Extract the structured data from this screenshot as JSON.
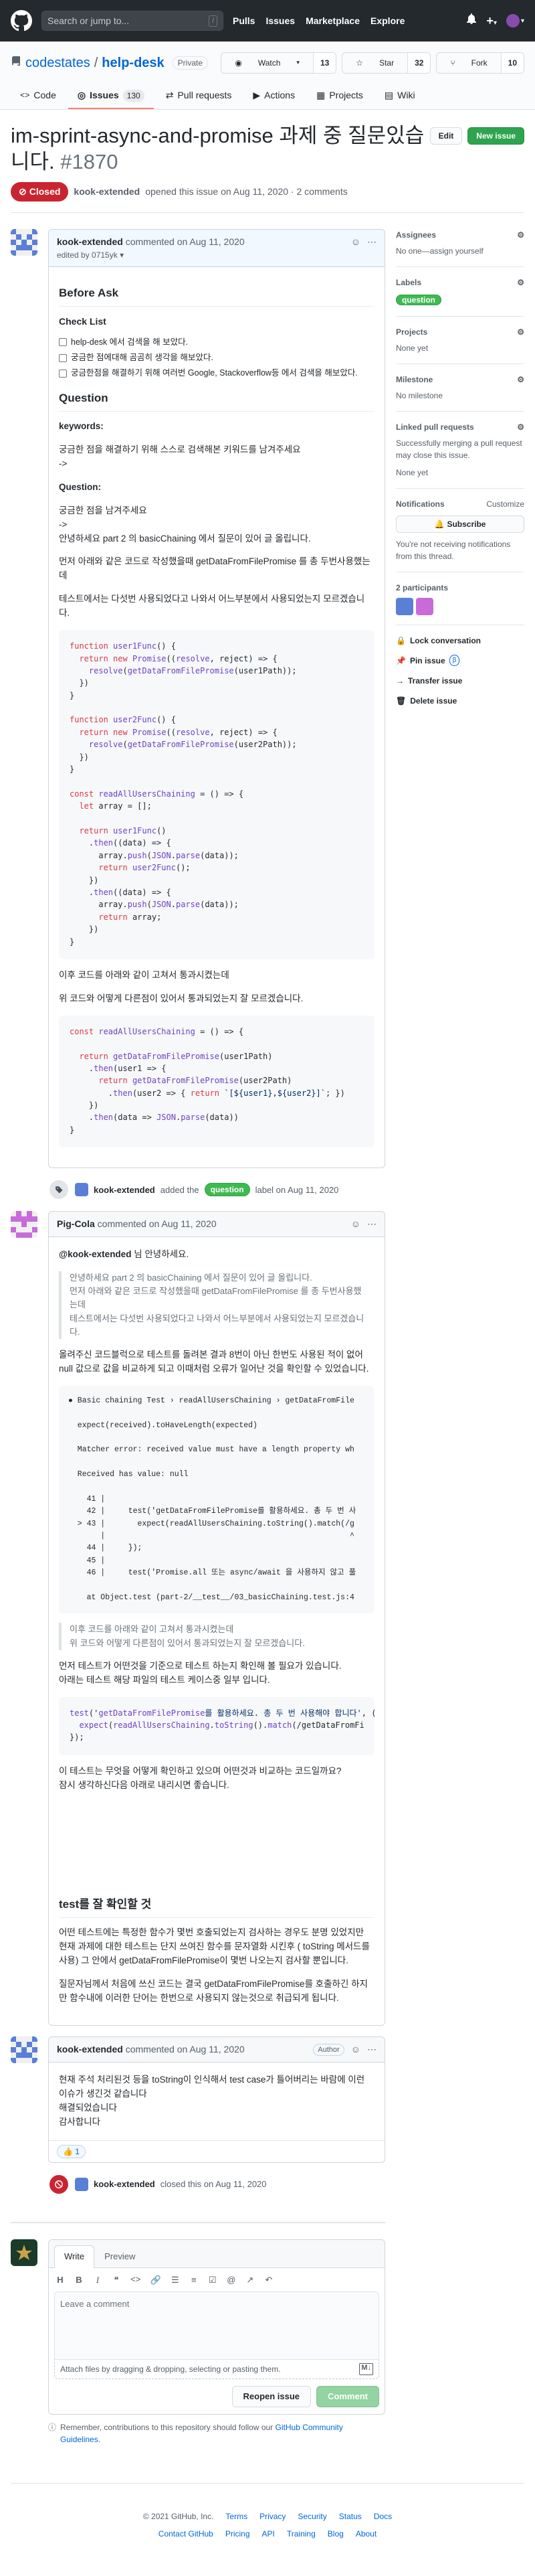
{
  "header": {
    "search_placeholder": "Search or jump to...",
    "search_hint": "/",
    "nav": [
      "Pulls",
      "Issues",
      "Marketplace",
      "Explore"
    ],
    "plus": "+",
    "caret": "▾"
  },
  "repo": {
    "owner": "codestates",
    "separator": "/",
    "name": "help-desk",
    "visibility": "Private",
    "watch": {
      "label": "Watch",
      "count": "13"
    },
    "star": {
      "label": "Star",
      "count": "32"
    },
    "fork": {
      "label": "Fork",
      "count": "10"
    },
    "tabs": [
      {
        "label": "Code"
      },
      {
        "label": "Issues",
        "count": "130"
      },
      {
        "label": "Pull requests"
      },
      {
        "label": "Actions"
      },
      {
        "label": "Projects"
      },
      {
        "label": "Wiki"
      }
    ]
  },
  "issue": {
    "title": "im-sprint-async-and-promise 과제 중 질문있습니다.",
    "number": "#1870",
    "edit_label": "Edit",
    "new_issue_label": "New issue",
    "state": "Closed",
    "author": "kook-extended",
    "opened_text": "opened this issue on Aug 11, 2020 · 2 comments"
  },
  "colors": {
    "accent": "#0366d6",
    "closed": "#cb2431",
    "open": "#2ea44f",
    "label_question": "#3fb950"
  },
  "first_comment": {
    "author": "kook-extended",
    "date_text": "commented on Aug 11, 2020",
    "edited_text": "edited by 0715yk",
    "h_before": "Before Ask",
    "h_checklist": "Check List",
    "checklist": [
      "help-desk 에서 검색을 해 보았다.",
      "궁금한 점에대해 곰곰히 생각을 해보았다.",
      "궁금한점을 해결하기 위해 여러번 Google, Stackoverflow등 에서 검색을 해보았다."
    ],
    "h_question": "Question",
    "keywords_label": "keywords:",
    "keywords_text": "궁금한 점을 해결하기 위해 스스로 검색해본 키워드를 남겨주세요",
    "arrow1": "->",
    "question_label": "Question:",
    "question_text": "궁금한 점을 남겨주세요",
    "arrow2": "->",
    "p1": "안녕하세요 part 2 의 basicChaining 에서 질문이 있어 글 올립니다.",
    "p2": "먼저 아래와 같은 코드로 작성했을때 getDataFromFilePromise 를 총 두번사용했는데",
    "p3": "테스트에서는 다섯번 사용되었다고 나와서 어느부분에서 사용되었는지 모르겠습니다.",
    "code1": "function user1Func() {\n  return new Promise((resolve, reject) => {\n    resolve(getDataFromFilePromise(user1Path));\n  })\n}\n\nfunction user2Func() {\n  return new Promise((resolve, reject) => {\n    resolve(getDataFromFilePromise(user2Path));\n  })\n}\n\nconst readAllUsersChaining = () => {\n  let array = [];\n\n  return user1Func()\n    .then((data) => {\n      array.push(JSON.parse(data));\n      return user2Func();\n    })\n    .then((data) => {\n      array.push(JSON.parse(data));\n      return array;\n    })\n}",
    "p4": "이후 코드를 아래와 같이 고쳐서 통과시켰는데",
    "p5": "위 코드와 어떻게 다른점이 있어서 통과되었는지 잘 모르겠습니다.",
    "code2": "const readAllUsersChaining = () => {\n\n  return getDataFromFilePromise(user1Path)\n    .then(user1 => {\n      return getDataFromFilePromise(user2Path)\n        .then(user2 => { return `[${user1},${user2}]`; })\n    })\n    .then(data => JSON.parse(data))\n}"
  },
  "label_event": {
    "actor": "kook-extended",
    "action": "added the",
    "label": "question",
    "suffix": "label on Aug 11, 2020"
  },
  "second_comment": {
    "author": "Pig-Cola",
    "date_text": "commented on Aug 11, 2020",
    "mention": "@kook-extended",
    "greeting": "님 안녕하세요.",
    "quote1": "안녕하세요 part 2 의 basicChaining 에서 질문이 있어 글 올립니다.\n먼저 아래와 같은 코드로 작성했을때 getDataFromFilePromise 를 총 두번사용했는데\n테스트에서는 다섯번 사용되었다고 나와서 어느부분에서 사용되었는지 모르겠습니다.",
    "p1": "올려주신 코드블럭으로 테스트를 돌려본 결과 8번이 아닌 한번도 사용된 적이 없어 null 값으로 값을 비교하게 되고 이때처럼 오류가 일어난 것을 확인할 수 있었습니다.",
    "terminal": "● Basic chaining Test › readAllUsersChaining › getDataFromFile\n\n  expect(received).toHaveLength(expected)\n\n  Matcher error: received value must have a length property wh\n\n  Received has value: null\n\n    41 |\n    42 |     test('getDataFromFilePromise를 활용하세요. 총 두 번 사\n  > 43 |       expect(readAllUsersChaining.toString().match(/g\n       |                                                     ^\n    44 |     });\n    45 |\n    46 |     test('Promise.all 또는 async/await 을 사용하지 않고 풀\n\n    at Object.test (part-2/__test__/03_basicChaining.test.js:4",
    "quote2": "이후 코드를 아래와 같이 고쳐서 통과시켰는데\n위 코드와 어떻게 다른점이 있어서 통과되었는지 잘 모르겠습니다.",
    "p2": "먼저 테스트가 어떤것을 기준으로 테스트 하는지 확인해 볼 필요가 있습니다.\n아래는 테스트 해당 파일의 테스트 케이스중 일부 입니다.",
    "code": "test('getDataFromFilePromise를 활용하세요. 총 두 번 사용해야 합니다', () =>\n  expect(readAllUsersChaining.toString().match(/getDataFromFi\n});",
    "p3": "이 테스트는 무엇을 어떻게 확인하고 있으며 어떤것과 비교하는 코드일까요?\n잠시 생각하신다음 아래로 내리시면 좋습니다.",
    "h_test": "test를 잘 확인할 것",
    "p4": "어떤 테스트에는 특정한 함수가 몇번 호출되었는지 검사하는 경우도 분명 있었지만 현재 과제에 대한 테스트는 단지 쓰여진 함수를 문자열화 시킨후 ( toString 메서드를 사용) 그 안에서 getDataFromFilePromise이 몇번 나오는지 검사할 뿐입니다.",
    "p5": "질문자님께서 처음에 쓰신 코드는 결국 getDataFromFilePromise를 호출하긴 하지만 함수내에 이러한 단어는 한번으로 사용되지 않는것으로 취급되게 됩니다."
  },
  "third_comment": {
    "author": "kook-extended",
    "date_text": "commented on Aug 11, 2020",
    "badge": "Author",
    "body": "현재 주석 처리된것 등을 toString이 인식해서 test case가 틀어버리는 바람에 이런 이슈가 생긴것 같습니다\n해결되었습니다\n감사합니다",
    "reaction": "1"
  },
  "close_event": {
    "actor": "kook-extended",
    "text": "closed this on Aug 11, 2020"
  },
  "composer": {
    "tab_write": "Write",
    "tab_preview": "Preview",
    "placeholder": "Leave a comment",
    "attach_text": "Attach files by dragging & dropping, selecting or pasting them.",
    "reopen_label": "Reopen issue",
    "comment_label": "Comment",
    "remember_prefix": "Remember, contributions to this repository should follow our",
    "remember_link": "GitHub Community Guidelines",
    "remember_suffix": "."
  },
  "sidebar": {
    "assignees": {
      "title": "Assignees",
      "value": "No one—assign yourself"
    },
    "labels": {
      "title": "Labels",
      "value": "question"
    },
    "projects": {
      "title": "Projects",
      "value": "None yet"
    },
    "milestone": {
      "title": "Milestone",
      "value": "No milestone"
    },
    "linked": {
      "title": "Linked pull requests",
      "value": "Successfully merging a pull request may close this issue.",
      "value2": "None yet"
    },
    "notifications": {
      "title": "Notifications",
      "customize": "Customize",
      "button": "Subscribe",
      "note": "You're not receiving notifications from this thread."
    },
    "participants": {
      "title": "2 participants"
    },
    "actions": [
      "Lock conversation",
      "Pin issue",
      "Transfer issue",
      "Delete issue"
    ],
    "pin_badge": "β"
  },
  "footer": {
    "copyright": "© 2021 GitHub, Inc.",
    "row1": [
      "Terms",
      "Privacy",
      "Security",
      "Status",
      "Docs"
    ],
    "row2": [
      "Contact GitHub",
      "Pricing",
      "API",
      "Training",
      "Blog",
      "About"
    ]
  }
}
